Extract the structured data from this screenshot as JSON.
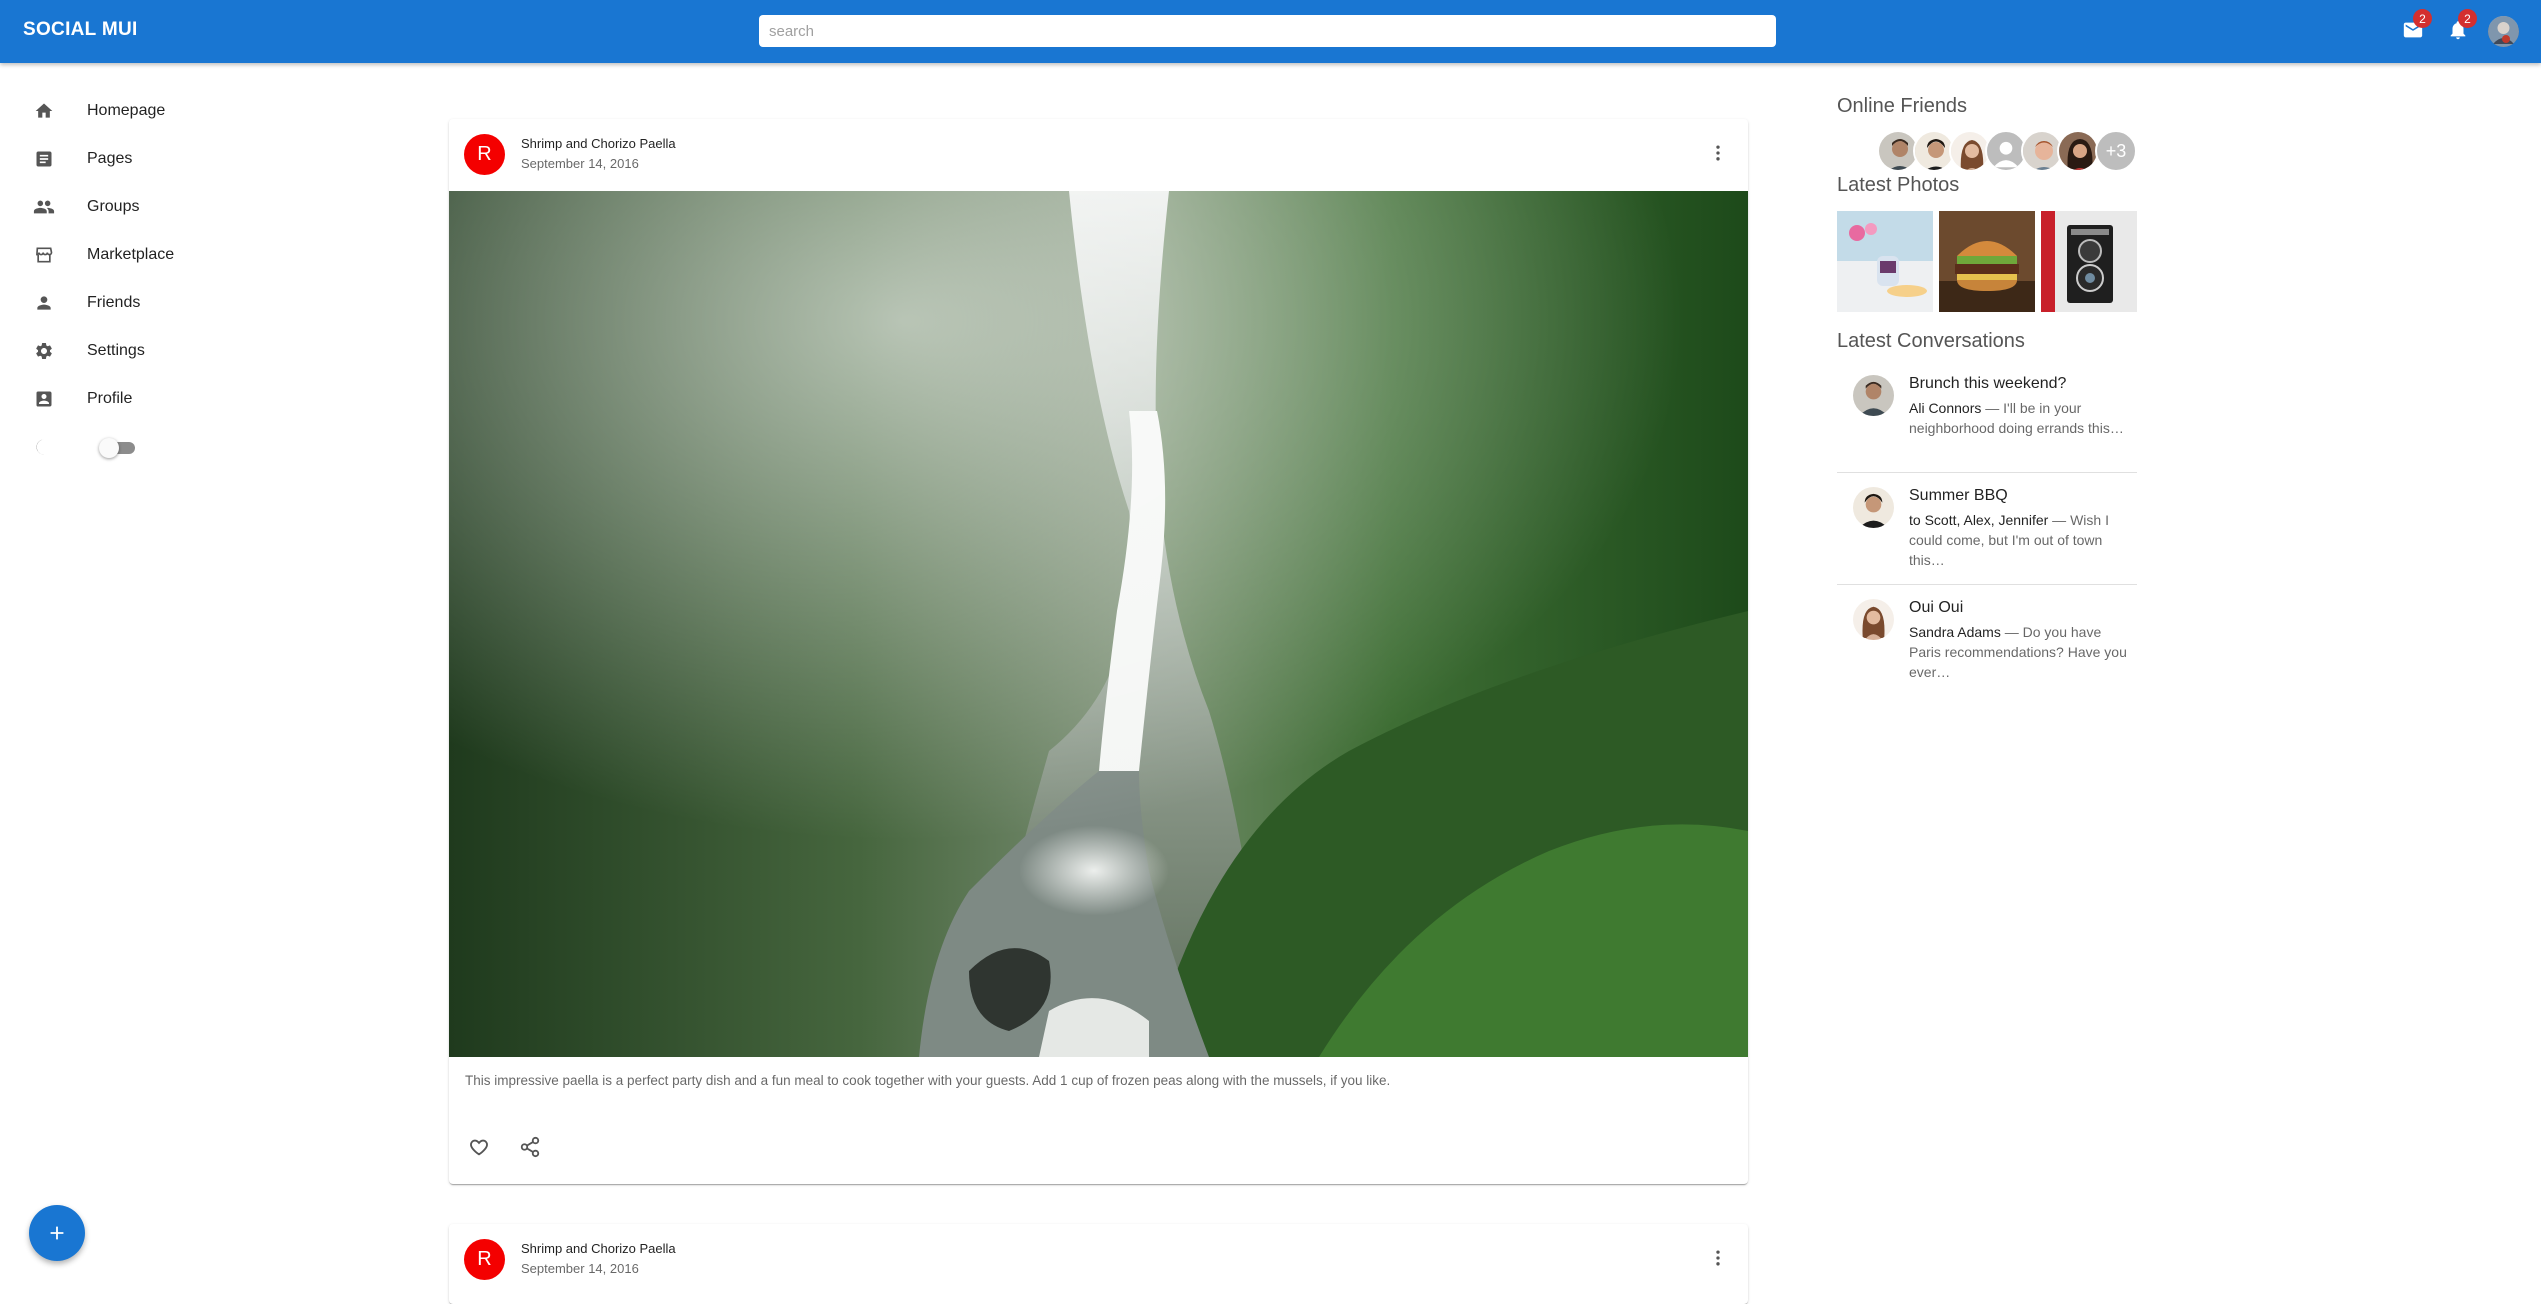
{
  "appbar": {
    "logo": "SOCIAL MUI",
    "search_placeholder": "search",
    "mail_badge": "2",
    "notifications_badge": "2"
  },
  "sidebar": {
    "items": [
      {
        "label": "Homepage",
        "icon": "home-icon"
      },
      {
        "label": "Pages",
        "icon": "article-icon"
      },
      {
        "label": "Groups",
        "icon": "groups-icon"
      },
      {
        "label": "Marketplace",
        "icon": "storefront-icon"
      },
      {
        "label": "Friends",
        "icon": "person-icon"
      },
      {
        "label": "Settings",
        "icon": "gear-icon"
      },
      {
        "label": "Profile",
        "icon": "account-box-icon"
      }
    ],
    "theme_toggle_icon": "dark-mode-icon"
  },
  "posts": [
    {
      "avatar_letter": "R",
      "title": "Shrimp and Chorizo Paella",
      "date": "September 14, 2016",
      "body": "This impressive paella is a perfect party dish and a fun meal to cook together with your guests. Add 1 cup of frozen peas along with the mussels, if you like."
    },
    {
      "avatar_letter": "R",
      "title": "Shrimp and Chorizo Paella",
      "date": "September 14, 2016"
    }
  ],
  "rightbar": {
    "online_title": "Online Friends",
    "online_more": "+3",
    "photos_title": "Latest Photos",
    "conversations_title": "Latest Conversations",
    "conversations": [
      {
        "title": "Brunch this weekend?",
        "from": "Ali Connors",
        "text": " — I'll be in your neighborhood doing errands this…"
      },
      {
        "title": "Summer BBQ",
        "from": "to Scott, Alex, Jennifer",
        "text": " — Wish I could come, but I'm out of town this…"
      },
      {
        "title": "Oui Oui",
        "from": "Sandra Adams",
        "text": " — Do you have Paris recommendations? Have you ever…"
      }
    ]
  },
  "colors": {
    "primary": "#1976d2",
    "avatar_red": "#f40000",
    "badge_red": "#d32f2f"
  }
}
